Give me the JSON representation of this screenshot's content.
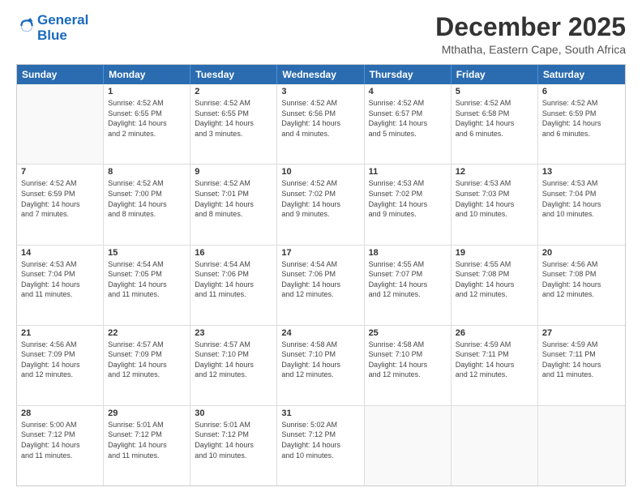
{
  "logo": {
    "line1": "General",
    "line2": "Blue"
  },
  "title": "December 2025",
  "subtitle": "Mthatha, Eastern Cape, South Africa",
  "header_days": [
    "Sunday",
    "Monday",
    "Tuesday",
    "Wednesday",
    "Thursday",
    "Friday",
    "Saturday"
  ],
  "weeks": [
    [
      {
        "day": "",
        "info": ""
      },
      {
        "day": "1",
        "info": "Sunrise: 4:52 AM\nSunset: 6:55 PM\nDaylight: 14 hours\nand 2 minutes."
      },
      {
        "day": "2",
        "info": "Sunrise: 4:52 AM\nSunset: 6:55 PM\nDaylight: 14 hours\nand 3 minutes."
      },
      {
        "day": "3",
        "info": "Sunrise: 4:52 AM\nSunset: 6:56 PM\nDaylight: 14 hours\nand 4 minutes."
      },
      {
        "day": "4",
        "info": "Sunrise: 4:52 AM\nSunset: 6:57 PM\nDaylight: 14 hours\nand 5 minutes."
      },
      {
        "day": "5",
        "info": "Sunrise: 4:52 AM\nSunset: 6:58 PM\nDaylight: 14 hours\nand 6 minutes."
      },
      {
        "day": "6",
        "info": "Sunrise: 4:52 AM\nSunset: 6:59 PM\nDaylight: 14 hours\nand 6 minutes."
      }
    ],
    [
      {
        "day": "7",
        "info": "Sunrise: 4:52 AM\nSunset: 6:59 PM\nDaylight: 14 hours\nand 7 minutes."
      },
      {
        "day": "8",
        "info": "Sunrise: 4:52 AM\nSunset: 7:00 PM\nDaylight: 14 hours\nand 8 minutes."
      },
      {
        "day": "9",
        "info": "Sunrise: 4:52 AM\nSunset: 7:01 PM\nDaylight: 14 hours\nand 8 minutes."
      },
      {
        "day": "10",
        "info": "Sunrise: 4:52 AM\nSunset: 7:02 PM\nDaylight: 14 hours\nand 9 minutes."
      },
      {
        "day": "11",
        "info": "Sunrise: 4:53 AM\nSunset: 7:02 PM\nDaylight: 14 hours\nand 9 minutes."
      },
      {
        "day": "12",
        "info": "Sunrise: 4:53 AM\nSunset: 7:03 PM\nDaylight: 14 hours\nand 10 minutes."
      },
      {
        "day": "13",
        "info": "Sunrise: 4:53 AM\nSunset: 7:04 PM\nDaylight: 14 hours\nand 10 minutes."
      }
    ],
    [
      {
        "day": "14",
        "info": "Sunrise: 4:53 AM\nSunset: 7:04 PM\nDaylight: 14 hours\nand 11 minutes."
      },
      {
        "day": "15",
        "info": "Sunrise: 4:54 AM\nSunset: 7:05 PM\nDaylight: 14 hours\nand 11 minutes."
      },
      {
        "day": "16",
        "info": "Sunrise: 4:54 AM\nSunset: 7:06 PM\nDaylight: 14 hours\nand 11 minutes."
      },
      {
        "day": "17",
        "info": "Sunrise: 4:54 AM\nSunset: 7:06 PM\nDaylight: 14 hours\nand 12 minutes."
      },
      {
        "day": "18",
        "info": "Sunrise: 4:55 AM\nSunset: 7:07 PM\nDaylight: 14 hours\nand 12 minutes."
      },
      {
        "day": "19",
        "info": "Sunrise: 4:55 AM\nSunset: 7:08 PM\nDaylight: 14 hours\nand 12 minutes."
      },
      {
        "day": "20",
        "info": "Sunrise: 4:56 AM\nSunset: 7:08 PM\nDaylight: 14 hours\nand 12 minutes."
      }
    ],
    [
      {
        "day": "21",
        "info": "Sunrise: 4:56 AM\nSunset: 7:09 PM\nDaylight: 14 hours\nand 12 minutes."
      },
      {
        "day": "22",
        "info": "Sunrise: 4:57 AM\nSunset: 7:09 PM\nDaylight: 14 hours\nand 12 minutes."
      },
      {
        "day": "23",
        "info": "Sunrise: 4:57 AM\nSunset: 7:10 PM\nDaylight: 14 hours\nand 12 minutes."
      },
      {
        "day": "24",
        "info": "Sunrise: 4:58 AM\nSunset: 7:10 PM\nDaylight: 14 hours\nand 12 minutes."
      },
      {
        "day": "25",
        "info": "Sunrise: 4:58 AM\nSunset: 7:10 PM\nDaylight: 14 hours\nand 12 minutes."
      },
      {
        "day": "26",
        "info": "Sunrise: 4:59 AM\nSunset: 7:11 PM\nDaylight: 14 hours\nand 12 minutes."
      },
      {
        "day": "27",
        "info": "Sunrise: 4:59 AM\nSunset: 7:11 PM\nDaylight: 14 hours\nand 11 minutes."
      }
    ],
    [
      {
        "day": "28",
        "info": "Sunrise: 5:00 AM\nSunset: 7:12 PM\nDaylight: 14 hours\nand 11 minutes."
      },
      {
        "day": "29",
        "info": "Sunrise: 5:01 AM\nSunset: 7:12 PM\nDaylight: 14 hours\nand 11 minutes."
      },
      {
        "day": "30",
        "info": "Sunrise: 5:01 AM\nSunset: 7:12 PM\nDaylight: 14 hours\nand 10 minutes."
      },
      {
        "day": "31",
        "info": "Sunrise: 5:02 AM\nSunset: 7:12 PM\nDaylight: 14 hours\nand 10 minutes."
      },
      {
        "day": "",
        "info": ""
      },
      {
        "day": "",
        "info": ""
      },
      {
        "day": "",
        "info": ""
      }
    ]
  ]
}
